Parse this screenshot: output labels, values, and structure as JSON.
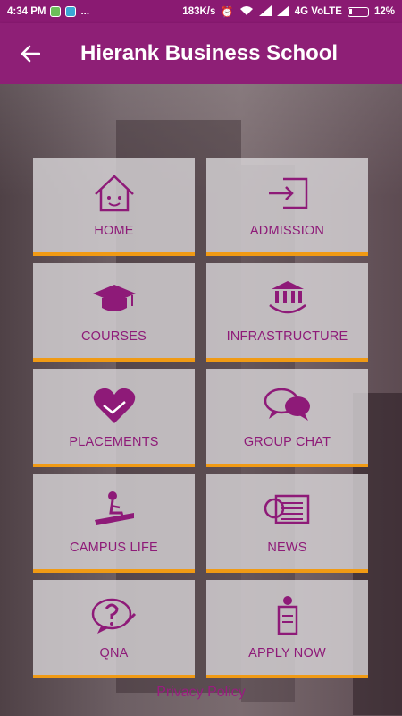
{
  "status_bar": {
    "time": "4:34 PM",
    "dots": "...",
    "speed": "183K/s",
    "network": "4G VoLTE",
    "battery": "12%"
  },
  "app_bar": {
    "back_icon": "arrow-left-icon",
    "title": "Hierank Business School"
  },
  "menu": [
    {
      "label": "HOME",
      "icon": "home-icon"
    },
    {
      "label": "ADMISSION",
      "icon": "sign-in-icon"
    },
    {
      "label": "COURSES",
      "icon": "graduation-cap-icon"
    },
    {
      "label": "INFRASTRUCTURE",
      "icon": "building-icon"
    },
    {
      "label": "PLACEMENTS",
      "icon": "handshake-heart-icon"
    },
    {
      "label": "GROUP CHAT",
      "icon": "chat-bubbles-icon"
    },
    {
      "label": "CAMPUS LIFE",
      "icon": "campus-life-icon"
    },
    {
      "label": "NEWS",
      "icon": "newspaper-icon"
    },
    {
      "label": "QNA",
      "icon": "question-bubble-icon"
    },
    {
      "label": "APPLY NOW",
      "icon": "apply-form-icon"
    }
  ],
  "footer": {
    "privacy_link": "Privacy Policy"
  },
  "colors": {
    "primary": "#8e1f76",
    "accent": "#f09a14",
    "tile_text": "#8e1a78"
  }
}
